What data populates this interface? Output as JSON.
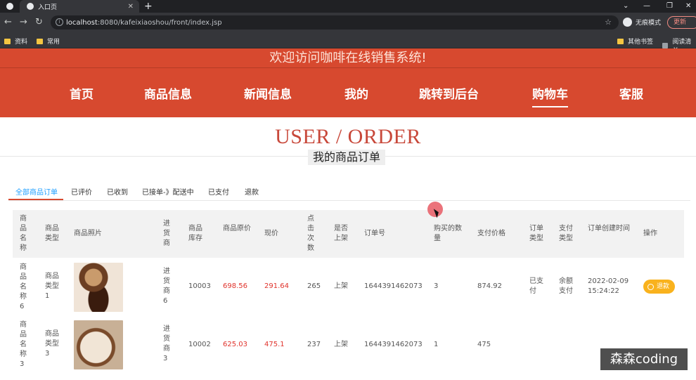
{
  "browser": {
    "tab_title": "入口页",
    "url_host": "localhost",
    "url_rest": ":8080/kafeixiaoshou/front/index.jsp",
    "incognito_label": "无痕模式",
    "update_label": "更新",
    "bookmarks": [
      "资料",
      "常用",
      "其他书签",
      "阅读清单"
    ]
  },
  "site": {
    "welcome": "欢迎访问咖啡在线销售系统!",
    "nav": [
      "首页",
      "商品信息",
      "新闻信息",
      "我的",
      "跳转到后台",
      "购物车",
      "客服"
    ]
  },
  "page": {
    "title_en": "USER / ORDER",
    "title_cn": "我的商品订单"
  },
  "tabs": [
    "全部商品订单",
    "已评价",
    "已收到",
    "已接单-》配送中",
    "已支付",
    "退款"
  ],
  "table": {
    "headers": [
      "商品名称",
      "商品类型",
      "商品照片",
      "进货商",
      "商品库存",
      "商品原价",
      "现价",
      "点击次数",
      "是否上架",
      "订单号",
      "购买的数量",
      "支付价格",
      "订单类型",
      "支付类型",
      "订单创建时间",
      "操作"
    ],
    "rows": [
      {
        "name": "商品名称6",
        "type": "商品类型1",
        "supplier": "进货商6",
        "stock": "10003",
        "orig_price": "698.56",
        "price": "291.64",
        "clicks": "265",
        "on_shelf": "上架",
        "order_no": "1644391462073",
        "qty": "3",
        "pay": "874.92",
        "order_type": "已支付",
        "pay_type": "余额支付",
        "created": "2022-02-09 15:24:22",
        "action": "退款"
      },
      {
        "name": "商品名称3",
        "type": "商品类型3",
        "supplier": "进货商3",
        "stock": "10002",
        "orig_price": "625.03",
        "price": "475.1",
        "clicks": "237",
        "on_shelf": "上架",
        "order_no": "1644391462073",
        "qty": "1",
        "pay": "475"
      }
    ]
  },
  "watermark": "森森coding"
}
